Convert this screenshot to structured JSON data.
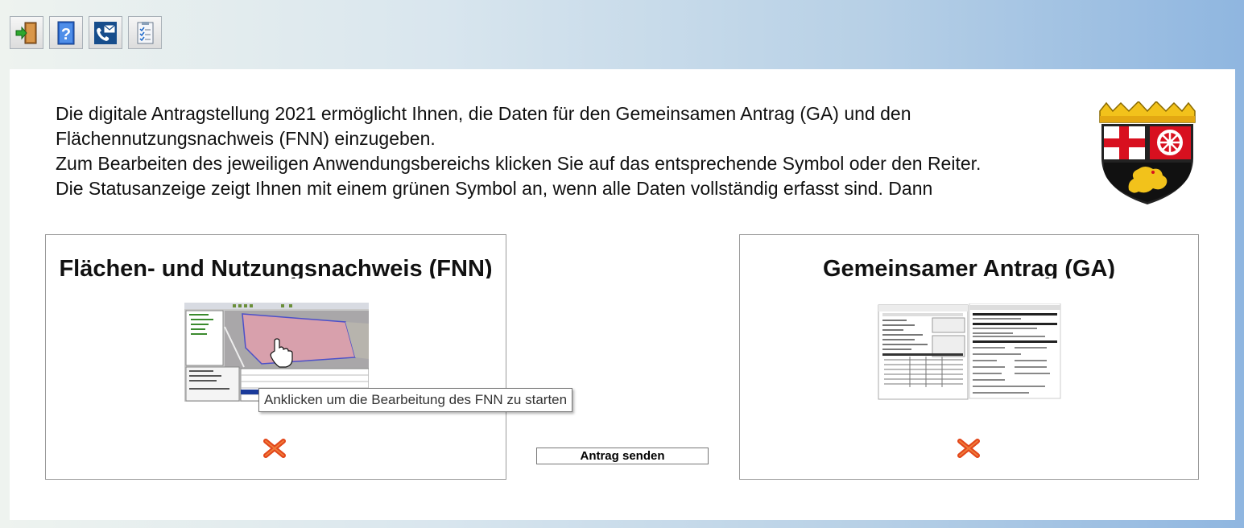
{
  "toolbar": {
    "buttons": [
      {
        "icon": "exit-door-icon",
        "label": ""
      },
      {
        "icon": "help-book-icon",
        "label": ""
      },
      {
        "icon": "phone-mail-contact-icon",
        "label": ""
      },
      {
        "icon": "checklist-icon",
        "label": ""
      }
    ]
  },
  "intro": {
    "paragraphs": [
      "Die digitale Antragstellung 2021 ermöglicht Ihnen, die Daten für den Gemeinsamen Antrag (GA) und den Flächennutzungsnachweis (FNN) einzugeben.",
      "Zum Bearbeiten des jeweiligen Anwendungsbereichs klicken Sie auf das entsprechende Symbol oder den Reiter.",
      "Die Statusanzeige zeigt Ihnen mit einem grünen Symbol an, wenn alle Daten vollständig erfasst sind. Dann"
    ]
  },
  "crest": {
    "icon": "rheinland-pfalz-coat-of-arms-icon"
  },
  "fnn": {
    "title": "Flächen- und Nutzungsnachweis (FNN)",
    "thumbnail_icon": "map-editor-screenshot-icon",
    "status_icon": "red-x-incomplete-icon",
    "tooltip": "Anklicken um die Bearbeitung des FNN zu starten"
  },
  "ga": {
    "title": "Gemeinsamer Antrag (GA)",
    "thumbnail_icon": "application-form-document-icon",
    "status_icon": "red-x-incomplete-icon"
  },
  "send_button": {
    "label": "Antrag senden"
  },
  "colors": {
    "status_incomplete": "#e2461a",
    "panel_bg": "#ffffff",
    "crest_red": "#d8101f",
    "crest_gold": "#f2c21b"
  }
}
